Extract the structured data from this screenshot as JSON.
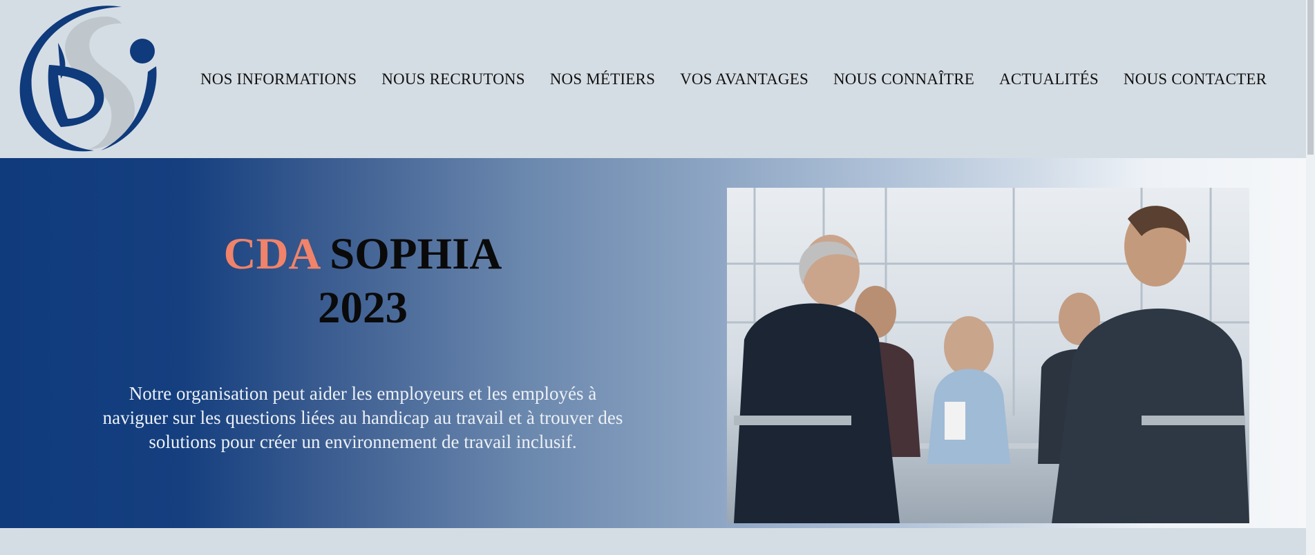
{
  "header": {
    "logo_alt": "DSi logo",
    "nav": [
      "NOS INFORMATIONS",
      "NOUS RECRUTONS",
      "NOS MÉTIERS",
      "VOS AVANTAGES",
      "NOUS CONNAÎTRE",
      "ACTUALITÉS",
      "NOUS CONTACTER"
    ]
  },
  "hero": {
    "title_accent": "CDA",
    "title_main": "SOPHIA",
    "title_year": "2023",
    "description": "Notre organisation peut aider les employeurs et les employés à naviguer sur les questions liées au handicap au travail et à trouver des solutions pour créer un environnement de travail inclusif."
  },
  "colors": {
    "accent": "#f0836a",
    "brand_blue": "#0f3a7c",
    "header_bg": "#d5dde4"
  },
  "icons": [
    "scroll-up-arrow-icon"
  ]
}
